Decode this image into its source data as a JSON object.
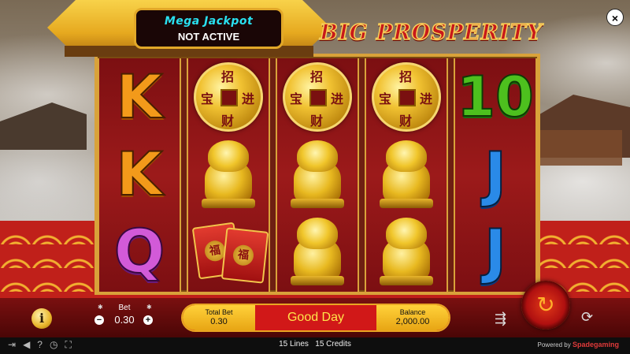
{
  "jackpot": {
    "title": "Mega Jackpot",
    "status": "NOT ACTIVE"
  },
  "logo": "BIG PROSPERITY",
  "close_label": "×",
  "reels": {
    "col1": [
      "K",
      "K",
      "Q"
    ],
    "col2": [
      "coin",
      "lion",
      "envelopes"
    ],
    "col3": [
      "coin",
      "lion",
      "lion"
    ],
    "col4": [
      "coin",
      "lion",
      "lion"
    ],
    "col5": [
      "10",
      "J",
      "J"
    ]
  },
  "coin_chars": {
    "top": "招",
    "left": "宝",
    "right": "进",
    "bottom": "财"
  },
  "envelope_char": "福",
  "controls": {
    "info_label": "i",
    "bet_label": "Bet",
    "bet_value": "0.30",
    "minus": "−",
    "plus": "+",
    "total_bet_label": "Total Bet",
    "total_bet_value": "0.30",
    "message": "Good Day",
    "balance_label": "Balance",
    "balance_value": "2,000.00",
    "autoplay_icon": "autoplay-icon",
    "spin_icon": "spin-icon",
    "turbo_icon": "turbo-icon"
  },
  "footer": {
    "lines": "15 Lines",
    "credits": "15 Credits",
    "powered_by": "Powered by",
    "brand": "Spadegaming",
    "icons": [
      "exit-icon",
      "sound-icon",
      "help-icon",
      "history-icon",
      "fullscreen-icon"
    ]
  }
}
